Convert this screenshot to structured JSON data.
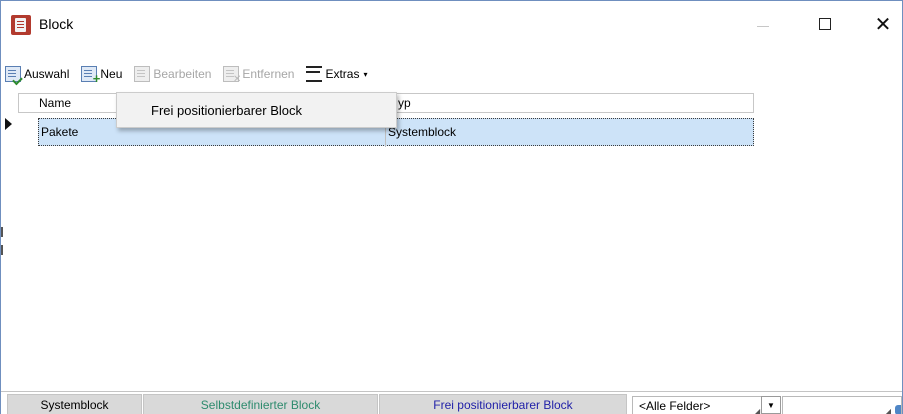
{
  "window": {
    "title": "Block",
    "controls": {
      "minimize": "—",
      "maximize": "☐",
      "close": "✕"
    }
  },
  "toolbar": {
    "items": [
      {
        "label": "Auswahl",
        "icon": "select-doc-icon",
        "enabled": true
      },
      {
        "label": "Neu",
        "icon": "new-doc-icon",
        "enabled": true
      },
      {
        "label": "Bearbeiten",
        "icon": "edit-doc-icon",
        "enabled": false
      },
      {
        "label": "Entfernen",
        "icon": "remove-doc-icon",
        "enabled": false
      },
      {
        "label": "Extras",
        "icon": "menu-icon",
        "enabled": true,
        "caret": "▾"
      }
    ]
  },
  "dropdown": {
    "items": [
      "Frei positionierbarer Block"
    ]
  },
  "grid": {
    "columns": [
      "Name",
      "yp"
    ],
    "rows": [
      {
        "name": "Pakete",
        "typ": "Systemblock",
        "selected": true
      }
    ],
    "selection_color": "#cde3f8"
  },
  "statusbar": {
    "tabs": [
      {
        "label": "Systemblock",
        "color": "#000000"
      },
      {
        "label": "Selbstdefinierter Block",
        "color": "#2e8b6e"
      },
      {
        "label": "Frei positionierbarer Block",
        "color": "#1f1fa8"
      }
    ],
    "filter_select": {
      "value": "<Alle Felder>"
    },
    "dropdown_arrow": "▼",
    "search_input": {
      "value": ""
    }
  }
}
